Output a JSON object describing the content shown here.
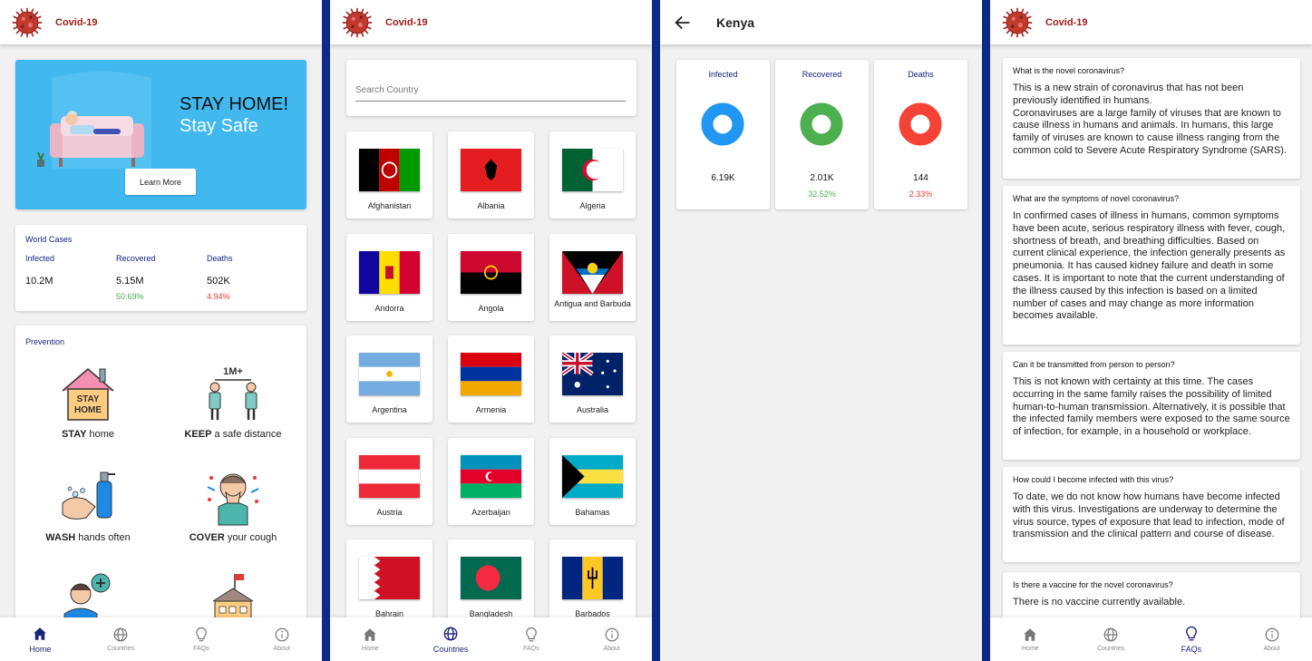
{
  "app": {
    "title": "Covid-19"
  },
  "colors": {
    "primary": "#1a237e",
    "accent": "#9b1a1a",
    "banner": "#41b8ee",
    "infected": "#2196f3",
    "recovered": "#4caf50",
    "deaths": "#f44336",
    "divider": "#0d2a8a"
  },
  "bottom_nav": [
    {
      "label": "Home",
      "icon": "home-icon"
    },
    {
      "label": "Countries",
      "icon": "globe-icon"
    },
    {
      "label": "FAQs",
      "icon": "lightbulb-icon"
    },
    {
      "label": "About",
      "icon": "info-icon"
    }
  ],
  "home": {
    "banner": {
      "headline": "STAY HOME!",
      "subline": "Stay Safe",
      "button": "Learn More"
    },
    "world": {
      "title": "World Cases",
      "infected_label": "Infected",
      "infected_value": "10.2M",
      "recovered_label": "Recovered",
      "recovered_value": "5.15M",
      "recovered_pct": "50.69%",
      "deaths_label": "Deaths",
      "deaths_value": "502K",
      "deaths_pct": "4.94%"
    },
    "prevention": {
      "title": "Prevention",
      "items": [
        {
          "bold": "STAY",
          "rest": " home",
          "icon": "stay-home-icon",
          "icon_text": [
            "STAY",
            "HOME"
          ]
        },
        {
          "bold": "KEEP",
          "rest": " a safe distance",
          "icon": "social-distance-icon",
          "icon_text": [
            "1M+"
          ]
        },
        {
          "bold": "WASH",
          "rest": " hands often",
          "icon": "wash-hands-icon"
        },
        {
          "bold": "COVER",
          "rest": " your cough",
          "icon": "cover-cough-icon"
        },
        {
          "bold": "",
          "rest": "",
          "icon": "call-doctor-icon"
        },
        {
          "bold": "",
          "rest": "",
          "icon": "hospital-icon"
        }
      ]
    }
  },
  "countries": {
    "search_placeholder": "Search Country",
    "list": [
      {
        "name": "Afghanistan"
      },
      {
        "name": "Albania"
      },
      {
        "name": "Algeria"
      },
      {
        "name": "Andorra"
      },
      {
        "name": "Angola"
      },
      {
        "name": "Antigua and Barbuda"
      },
      {
        "name": "Argentina"
      },
      {
        "name": "Armenia"
      },
      {
        "name": "Australia"
      },
      {
        "name": "Austria"
      },
      {
        "name": "Azerbaijan"
      },
      {
        "name": "Bahamas"
      },
      {
        "name": "Bahrain"
      },
      {
        "name": "Bangladesh"
      },
      {
        "name": "Barbados"
      }
    ]
  },
  "detail": {
    "country": "Kenya",
    "infected": {
      "label": "Infected",
      "value": "6.19K"
    },
    "recovered": {
      "label": "Recovered",
      "value": "2.01K",
      "pct": "32.52%"
    },
    "deaths": {
      "label": "Deaths",
      "value": "144",
      "pct": "2.33%"
    }
  },
  "faqs": [
    {
      "q": "What is the novel coronavirus?",
      "a": "This is a new strain of coronavirus that has not been previously identified in humans.\nCoronaviruses are a large family of viruses that are known to cause illness in humans and animals. In humans, this large family of viruses are known to cause illness ranging from the common cold to Severe Acute Respiratory Syndrome (SARS)."
    },
    {
      "q": "What are the symptoms of novel coronavirus?",
      "a": "In confirmed cases of illness in humans, common symptoms have been acute, serious respiratory illness with fever, cough, shortness of breath, and breathing difficulties. Based on current clinical experience, the infection generally presents as pneumonia. It has caused kidney failure and death in some cases. It is important to note that the current understanding of the illness caused by this infection is based on a limited number of cases and may change as more information becomes available."
    },
    {
      "q": "Can it be transmitted from person to person?",
      "a": "This is not known with certainty at this time. The cases occurring in the same family raises the possibility of limited human-to-human transmission. Alternatively, it is possible that the infected family members were exposed to the same source of infection, for example, in a household or workplace."
    },
    {
      "q": "How could I become infected with this virus?",
      "a": "To date, we do not know how humans have become infected with this virus. Investigations are underway to determine the virus source, types of exposure that lead to infection, mode of transmission and the clinical pattern and course of disease."
    },
    {
      "q": "Is there a vaccine for the novel coronavirus?",
      "a": "There is no vaccine currently available."
    }
  ]
}
